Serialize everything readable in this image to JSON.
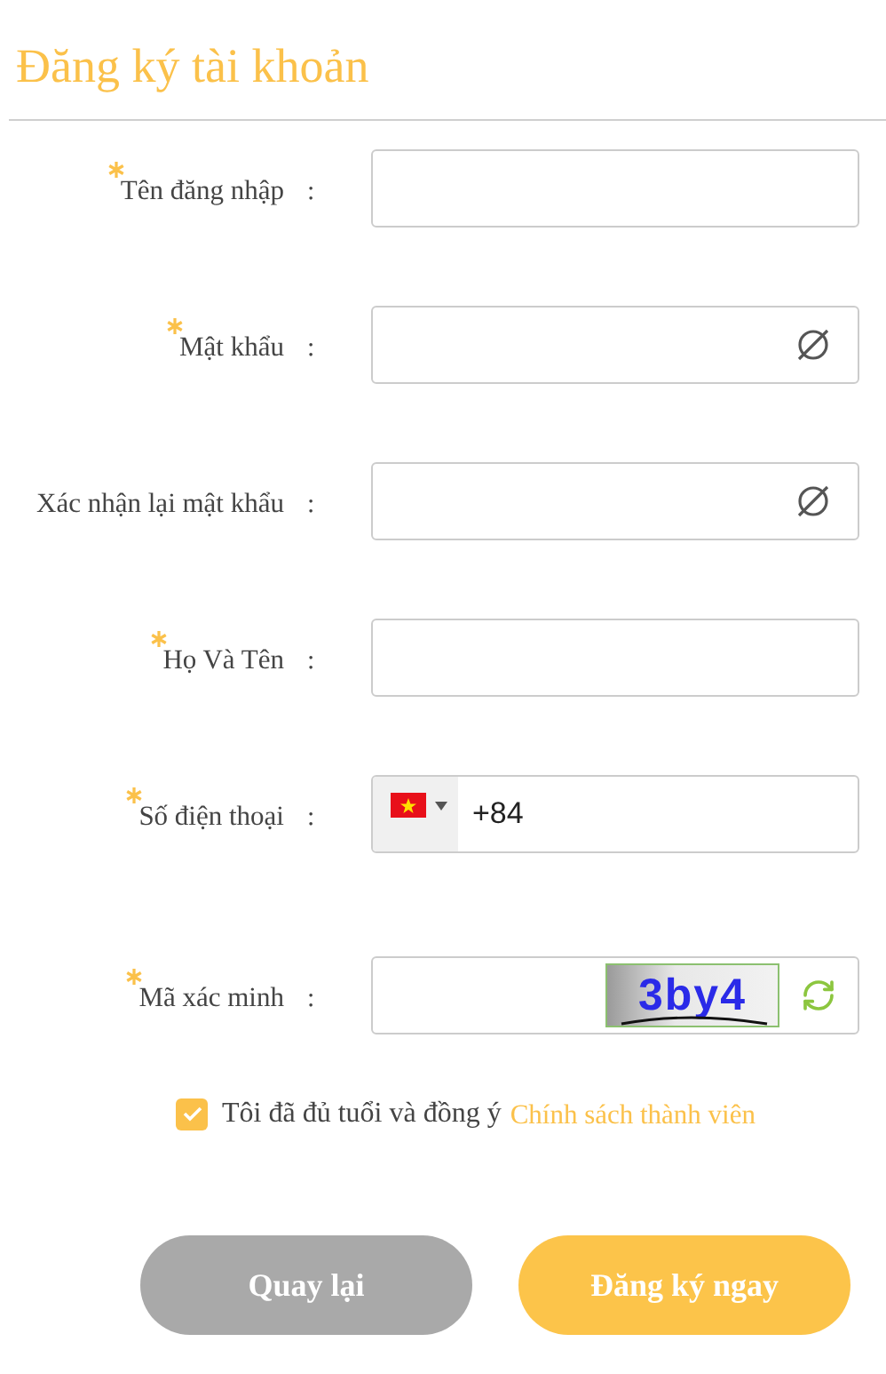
{
  "title": "Đăng ký tài khoản",
  "fields": [
    {
      "kind": "text",
      "label": "Tên đăng nhập",
      "separator": ":",
      "required": true
    },
    {
      "kind": "password",
      "label": "Mật khẩu",
      "separator": ":",
      "required": true
    },
    {
      "kind": "password",
      "label": "Xác nhận lại mật khẩu",
      "separator": ":",
      "required": false
    },
    {
      "kind": "text",
      "label": "Họ Và Tên",
      "separator": ":",
      "required": true
    },
    {
      "kind": "phone",
      "label": "Số điện thoại",
      "separator": ":",
      "required": true,
      "value": "+84"
    },
    {
      "kind": "captcha",
      "label": "Mã xác minh",
      "separator": ":",
      "required": true,
      "captcha_code": "3by4"
    }
  ],
  "agreement": {
    "checked": true,
    "text": "Tôi đã đủ tuổi và đồng ý",
    "link": "Chính sách thành viên"
  },
  "buttons": [
    {
      "kind": "secondary",
      "label": "Quay lại"
    },
    {
      "kind": "primary",
      "label": "Đăng ký ngay"
    }
  ]
}
